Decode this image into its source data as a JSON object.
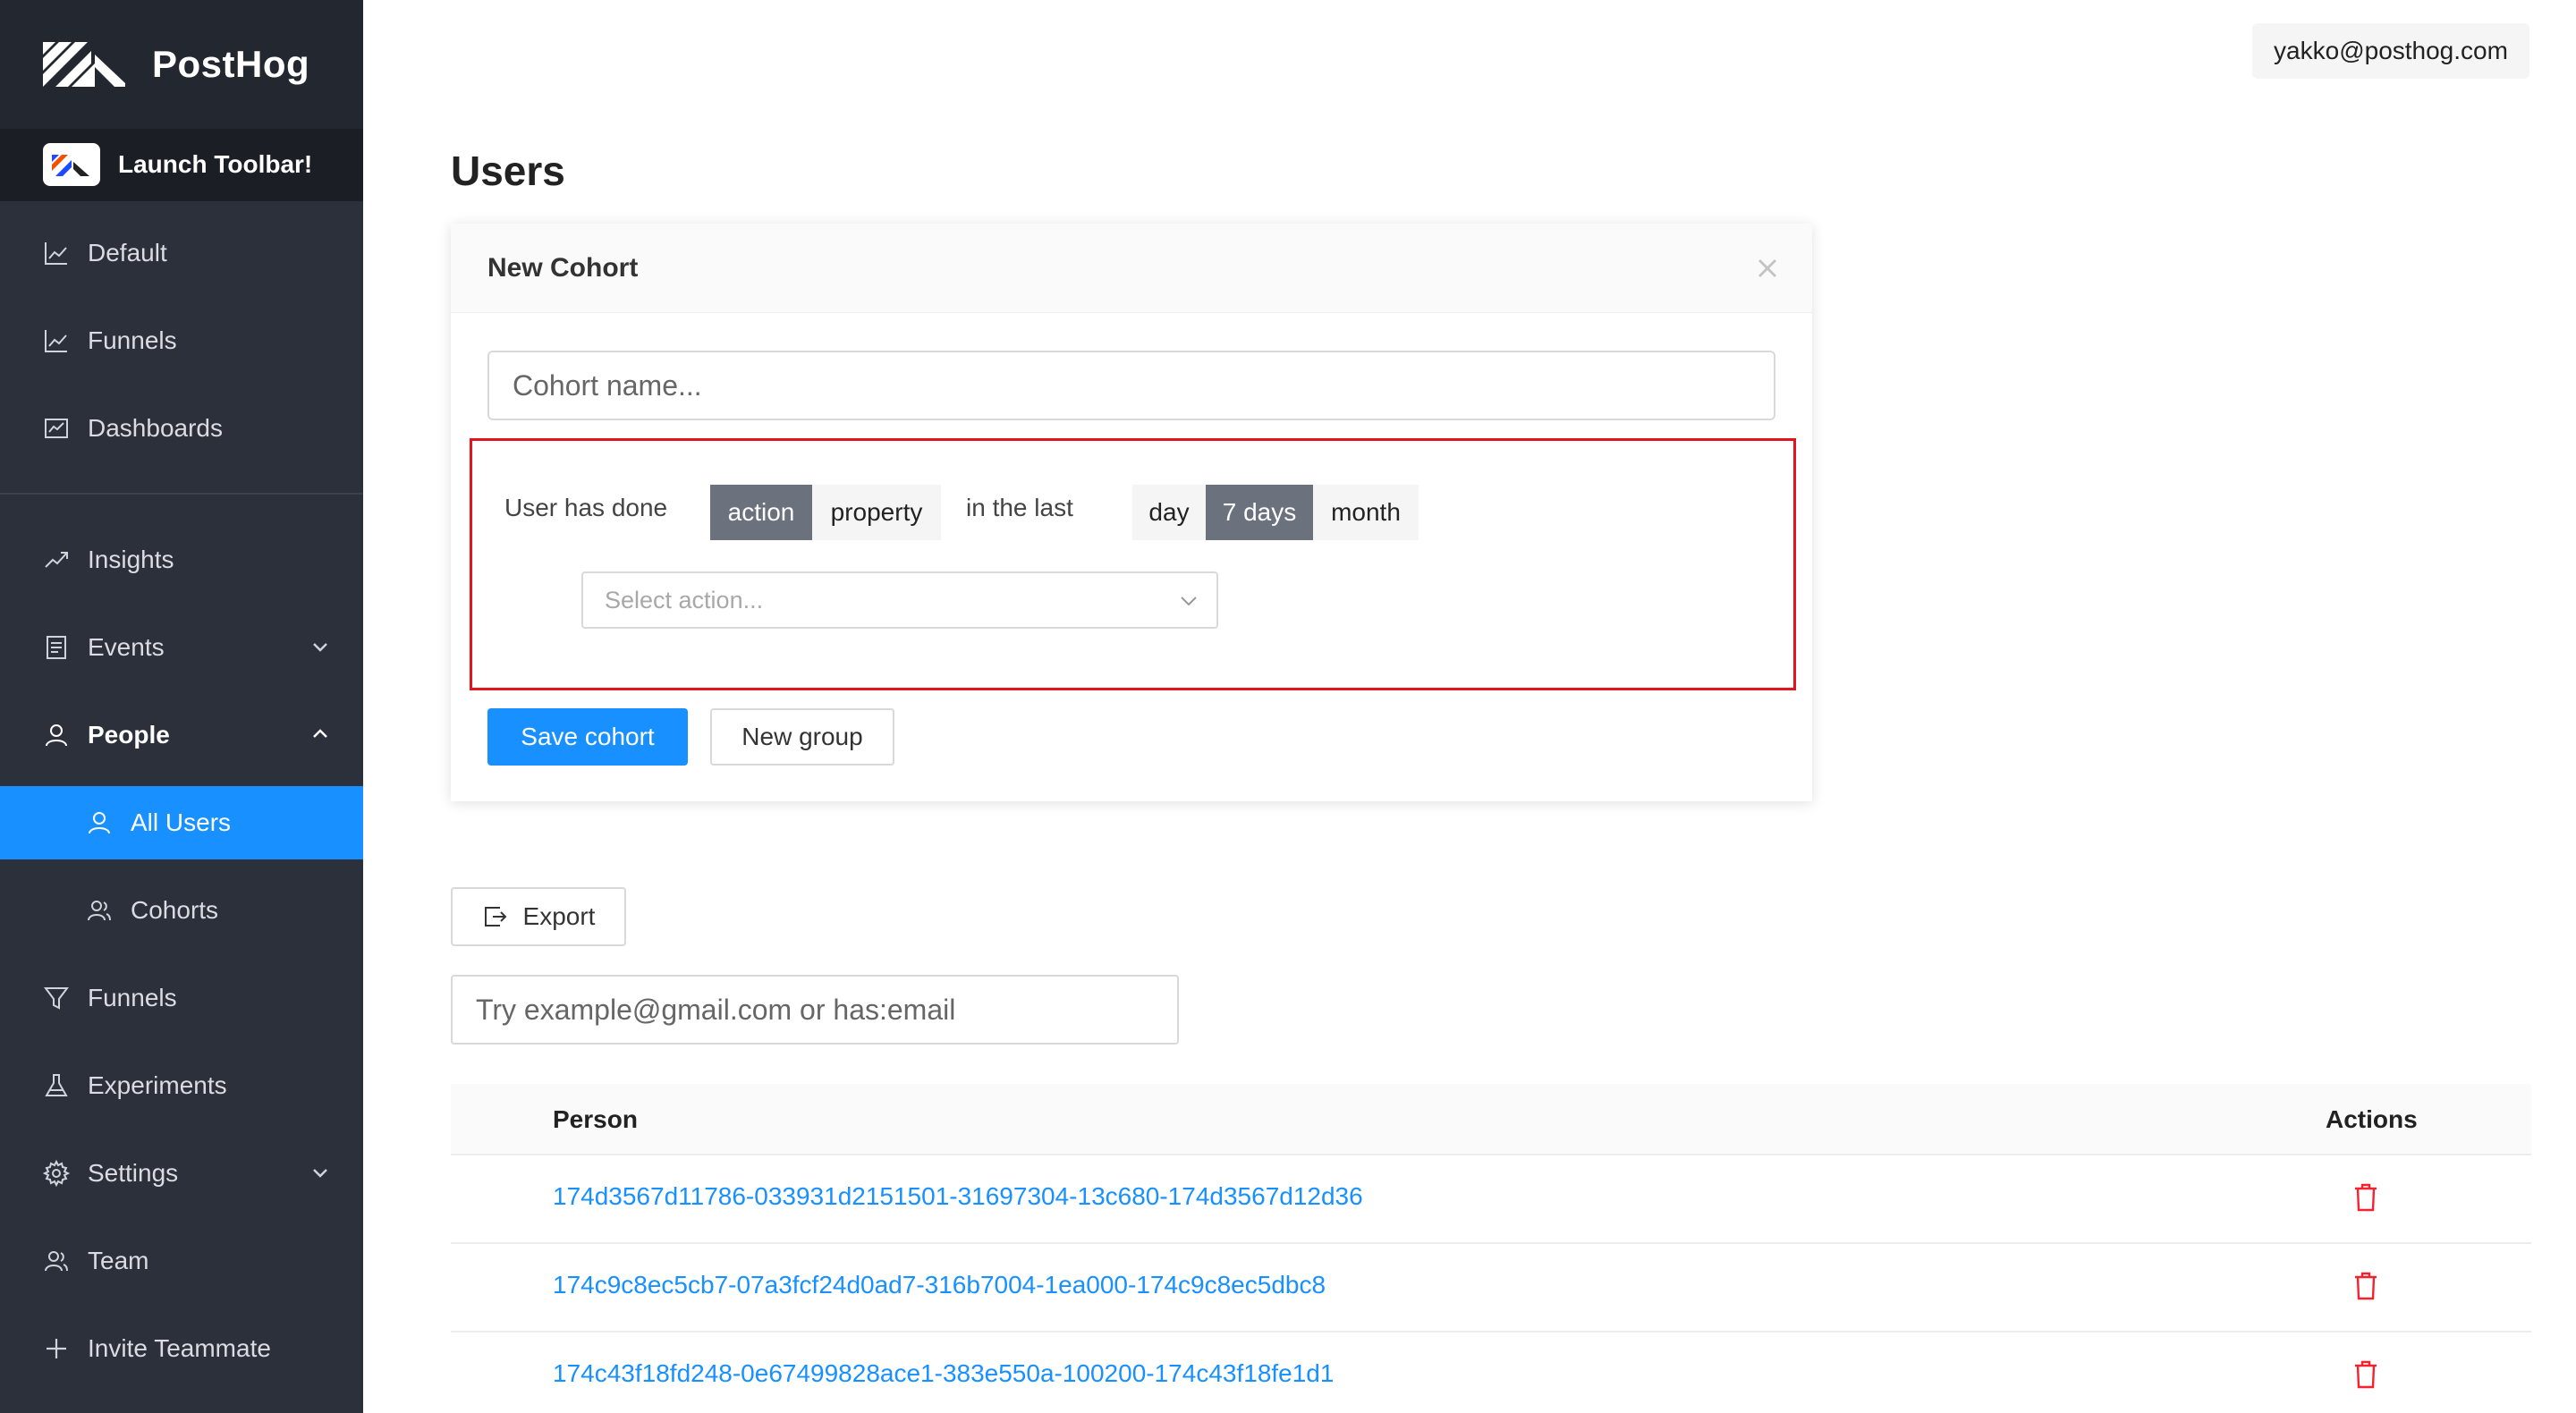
{
  "brand": {
    "name": "PostHog"
  },
  "toolbar": {
    "label": "Launch Toolbar!"
  },
  "sidebar": {
    "items": [
      {
        "label": "Default",
        "icon": "line-chart-icon"
      },
      {
        "label": "Funnels",
        "icon": "line-chart-icon"
      },
      {
        "label": "Dashboards",
        "icon": "dashboard-icon"
      },
      {
        "label": "Insights",
        "icon": "rise-icon"
      },
      {
        "label": "Events",
        "icon": "file-icon"
      },
      {
        "label": "People",
        "icon": "user-icon"
      },
      {
        "label": "All Users",
        "icon": "user-icon"
      },
      {
        "label": "Cohorts",
        "icon": "team-icon"
      },
      {
        "label": "Funnels",
        "icon": "funnel-icon"
      },
      {
        "label": "Experiments",
        "icon": "flask-icon"
      },
      {
        "label": "Settings",
        "icon": "gear-icon"
      },
      {
        "label": "Team",
        "icon": "team-icon"
      },
      {
        "label": "Invite Teammate",
        "icon": "plus-icon"
      }
    ]
  },
  "header": {
    "user_email": "yakko@posthog.com"
  },
  "page": {
    "title": "Users"
  },
  "cohort_card": {
    "title": "New Cohort",
    "name_placeholder": "Cohort name...",
    "group_label": "User has done",
    "type_options": [
      "action",
      "property"
    ],
    "type_selected": "action",
    "in_the_last": "in the last",
    "period_options": [
      "day",
      "7 days",
      "month"
    ],
    "period_selected": "7 days",
    "select_action_placeholder": "Select action...",
    "save_label": "Save cohort",
    "new_group_label": "New group"
  },
  "export": {
    "label": "Export"
  },
  "search": {
    "placeholder": "Try example@gmail.com or has:email"
  },
  "table": {
    "columns": [
      "Person",
      "Actions"
    ],
    "rows": [
      {
        "person": "174d3567d11786-033931d2151501-31697304-13c680-174d3567d12d36"
      },
      {
        "person": "174c9c8ec5cb7-07a3fcf24d0ad7-316b7004-1ea000-174c9c8ec5dbc8"
      },
      {
        "person": "174c43f18fd248-0e67499828ace1-383e550a-100200-174c43f18fe1d1"
      }
    ]
  },
  "colors": {
    "primary": "#1890ff",
    "sidebar": "#2b303a",
    "danger": "#e0151e"
  }
}
